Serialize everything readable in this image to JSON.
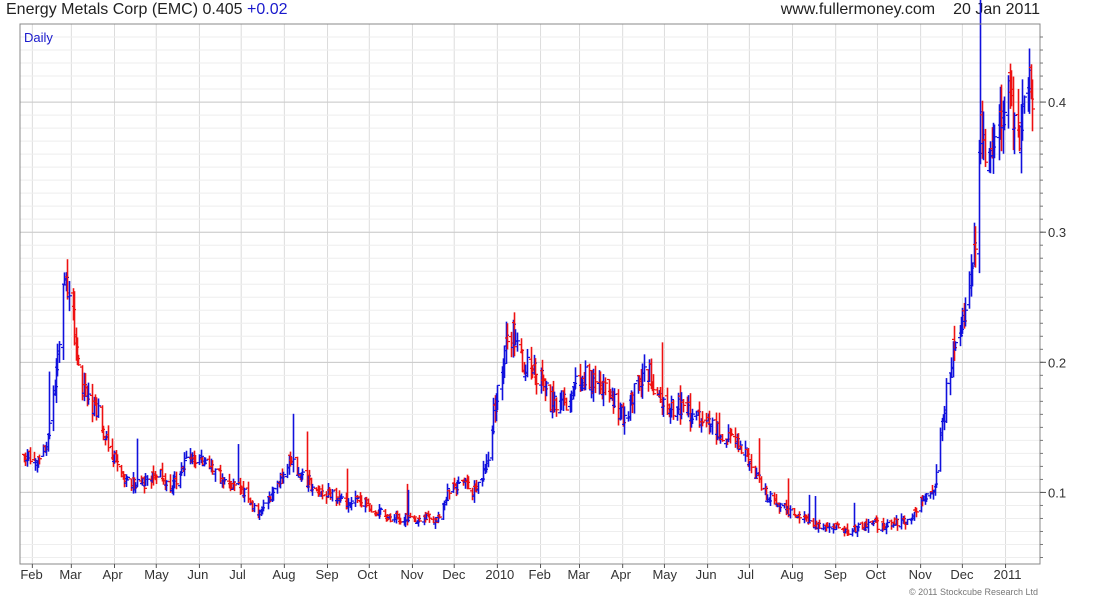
{
  "header": {
    "title": "Energy Metals Corp (EMC)",
    "price": "0.405",
    "change": "+0.02",
    "site": "www.fullermoney.com",
    "date": "20 Jan 2011"
  },
  "footer": {
    "copyright": "© 2011 Stockcube Research Ltd"
  },
  "colors": {
    "up": "#1111dd",
    "down": "#ee1111",
    "grid": "#dcdcdc",
    "frame": "#888888"
  },
  "chart_data": {
    "type": "ohlc",
    "period_label": "Daily",
    "y_ticks": [
      0.1,
      0.2,
      0.3,
      0.4
    ],
    "y_tick_labels": [
      "0.1",
      "0.2",
      "0.3",
      "0.4"
    ],
    "ylim": [
      0.045,
      0.46
    ],
    "x_tick_labels": [
      "Feb",
      "Mar",
      "Apr",
      "May",
      "Jun",
      "Jul",
      "Aug",
      "Sep",
      "Oct",
      "Nov",
      "Dec",
      "2010",
      "Feb",
      "Mar",
      "Apr",
      "May",
      "Jun",
      "Jul",
      "Aug",
      "Sep",
      "Oct",
      "Nov",
      "Dec",
      "2011"
    ],
    "x_range": [
      "2009-01-26",
      "2011-01-20"
    ],
    "grid": true,
    "price_series_anchors": [
      [
        "2009-01-26",
        0.13
      ],
      [
        "2009-02-05",
        0.125
      ],
      [
        "2009-02-12",
        0.14
      ],
      [
        "2009-02-18",
        0.19
      ],
      [
        "2009-02-24",
        0.26
      ],
      [
        "2009-03-02",
        0.24
      ],
      [
        "2009-03-06",
        0.19
      ],
      [
        "2009-03-12",
        0.17
      ],
      [
        "2009-03-20",
        0.16
      ],
      [
        "2009-03-30",
        0.13
      ],
      [
        "2009-04-08",
        0.11
      ],
      [
        "2009-04-20",
        0.105
      ],
      [
        "2009-05-01",
        0.115
      ],
      [
        "2009-05-12",
        0.105
      ],
      [
        "2009-05-25",
        0.13
      ],
      [
        "2009-06-05",
        0.12
      ],
      [
        "2009-06-20",
        0.11
      ],
      [
        "2009-07-02",
        0.1
      ],
      [
        "2009-07-12",
        0.085
      ],
      [
        "2009-07-25",
        0.1
      ],
      [
        "2009-08-05",
        0.125
      ],
      [
        "2009-08-15",
        0.11
      ],
      [
        "2009-08-30",
        0.1
      ],
      [
        "2009-09-15",
        0.095
      ],
      [
        "2009-09-30",
        0.09
      ],
      [
        "2009-10-15",
        0.08
      ],
      [
        "2009-10-30",
        0.08
      ],
      [
        "2009-11-20",
        0.08
      ],
      [
        "2009-11-26",
        0.1
      ],
      [
        "2009-12-05",
        0.11
      ],
      [
        "2009-12-15",
        0.1
      ],
      [
        "2009-12-24",
        0.12
      ],
      [
        "2009-12-30",
        0.17
      ],
      [
        "2010-01-06",
        0.21
      ],
      [
        "2010-01-12",
        0.22
      ],
      [
        "2010-01-20",
        0.2
      ],
      [
        "2010-01-30",
        0.19
      ],
      [
        "2010-02-08",
        0.17
      ],
      [
        "2010-02-15",
        0.165
      ],
      [
        "2010-02-25",
        0.18
      ],
      [
        "2010-03-05",
        0.19
      ],
      [
        "2010-03-15",
        0.185
      ],
      [
        "2010-03-25",
        0.17
      ],
      [
        "2010-04-03",
        0.155
      ],
      [
        "2010-04-12",
        0.19
      ],
      [
        "2010-04-20",
        0.19
      ],
      [
        "2010-05-01",
        0.165
      ],
      [
        "2010-05-12",
        0.165
      ],
      [
        "2010-05-22",
        0.16
      ],
      [
        "2010-06-05",
        0.15
      ],
      [
        "2010-06-20",
        0.14
      ],
      [
        "2010-07-01",
        0.125
      ],
      [
        "2010-07-12",
        0.1
      ],
      [
        "2010-07-20",
        0.09
      ],
      [
        "2010-08-01",
        0.085
      ],
      [
        "2010-08-15",
        0.075
      ],
      [
        "2010-08-30",
        0.075
      ],
      [
        "2010-09-10",
        0.07
      ],
      [
        "2010-09-25",
        0.075
      ],
      [
        "2010-10-10",
        0.075
      ],
      [
        "2010-10-25",
        0.08
      ],
      [
        "2010-11-01",
        0.095
      ],
      [
        "2010-11-10",
        0.1
      ],
      [
        "2010-11-18",
        0.17
      ],
      [
        "2010-11-24",
        0.21
      ],
      [
        "2010-11-30",
        0.22
      ],
      [
        "2010-12-05",
        0.25
      ],
      [
        "2010-12-10",
        0.3
      ],
      [
        "2010-12-14",
        0.38
      ],
      [
        "2010-12-20",
        0.36
      ],
      [
        "2010-12-26",
        0.39
      ],
      [
        "2011-01-03",
        0.4
      ],
      [
        "2011-01-10",
        0.37
      ],
      [
        "2011-01-15",
        0.41
      ],
      [
        "2011-01-20",
        0.405
      ]
    ]
  }
}
